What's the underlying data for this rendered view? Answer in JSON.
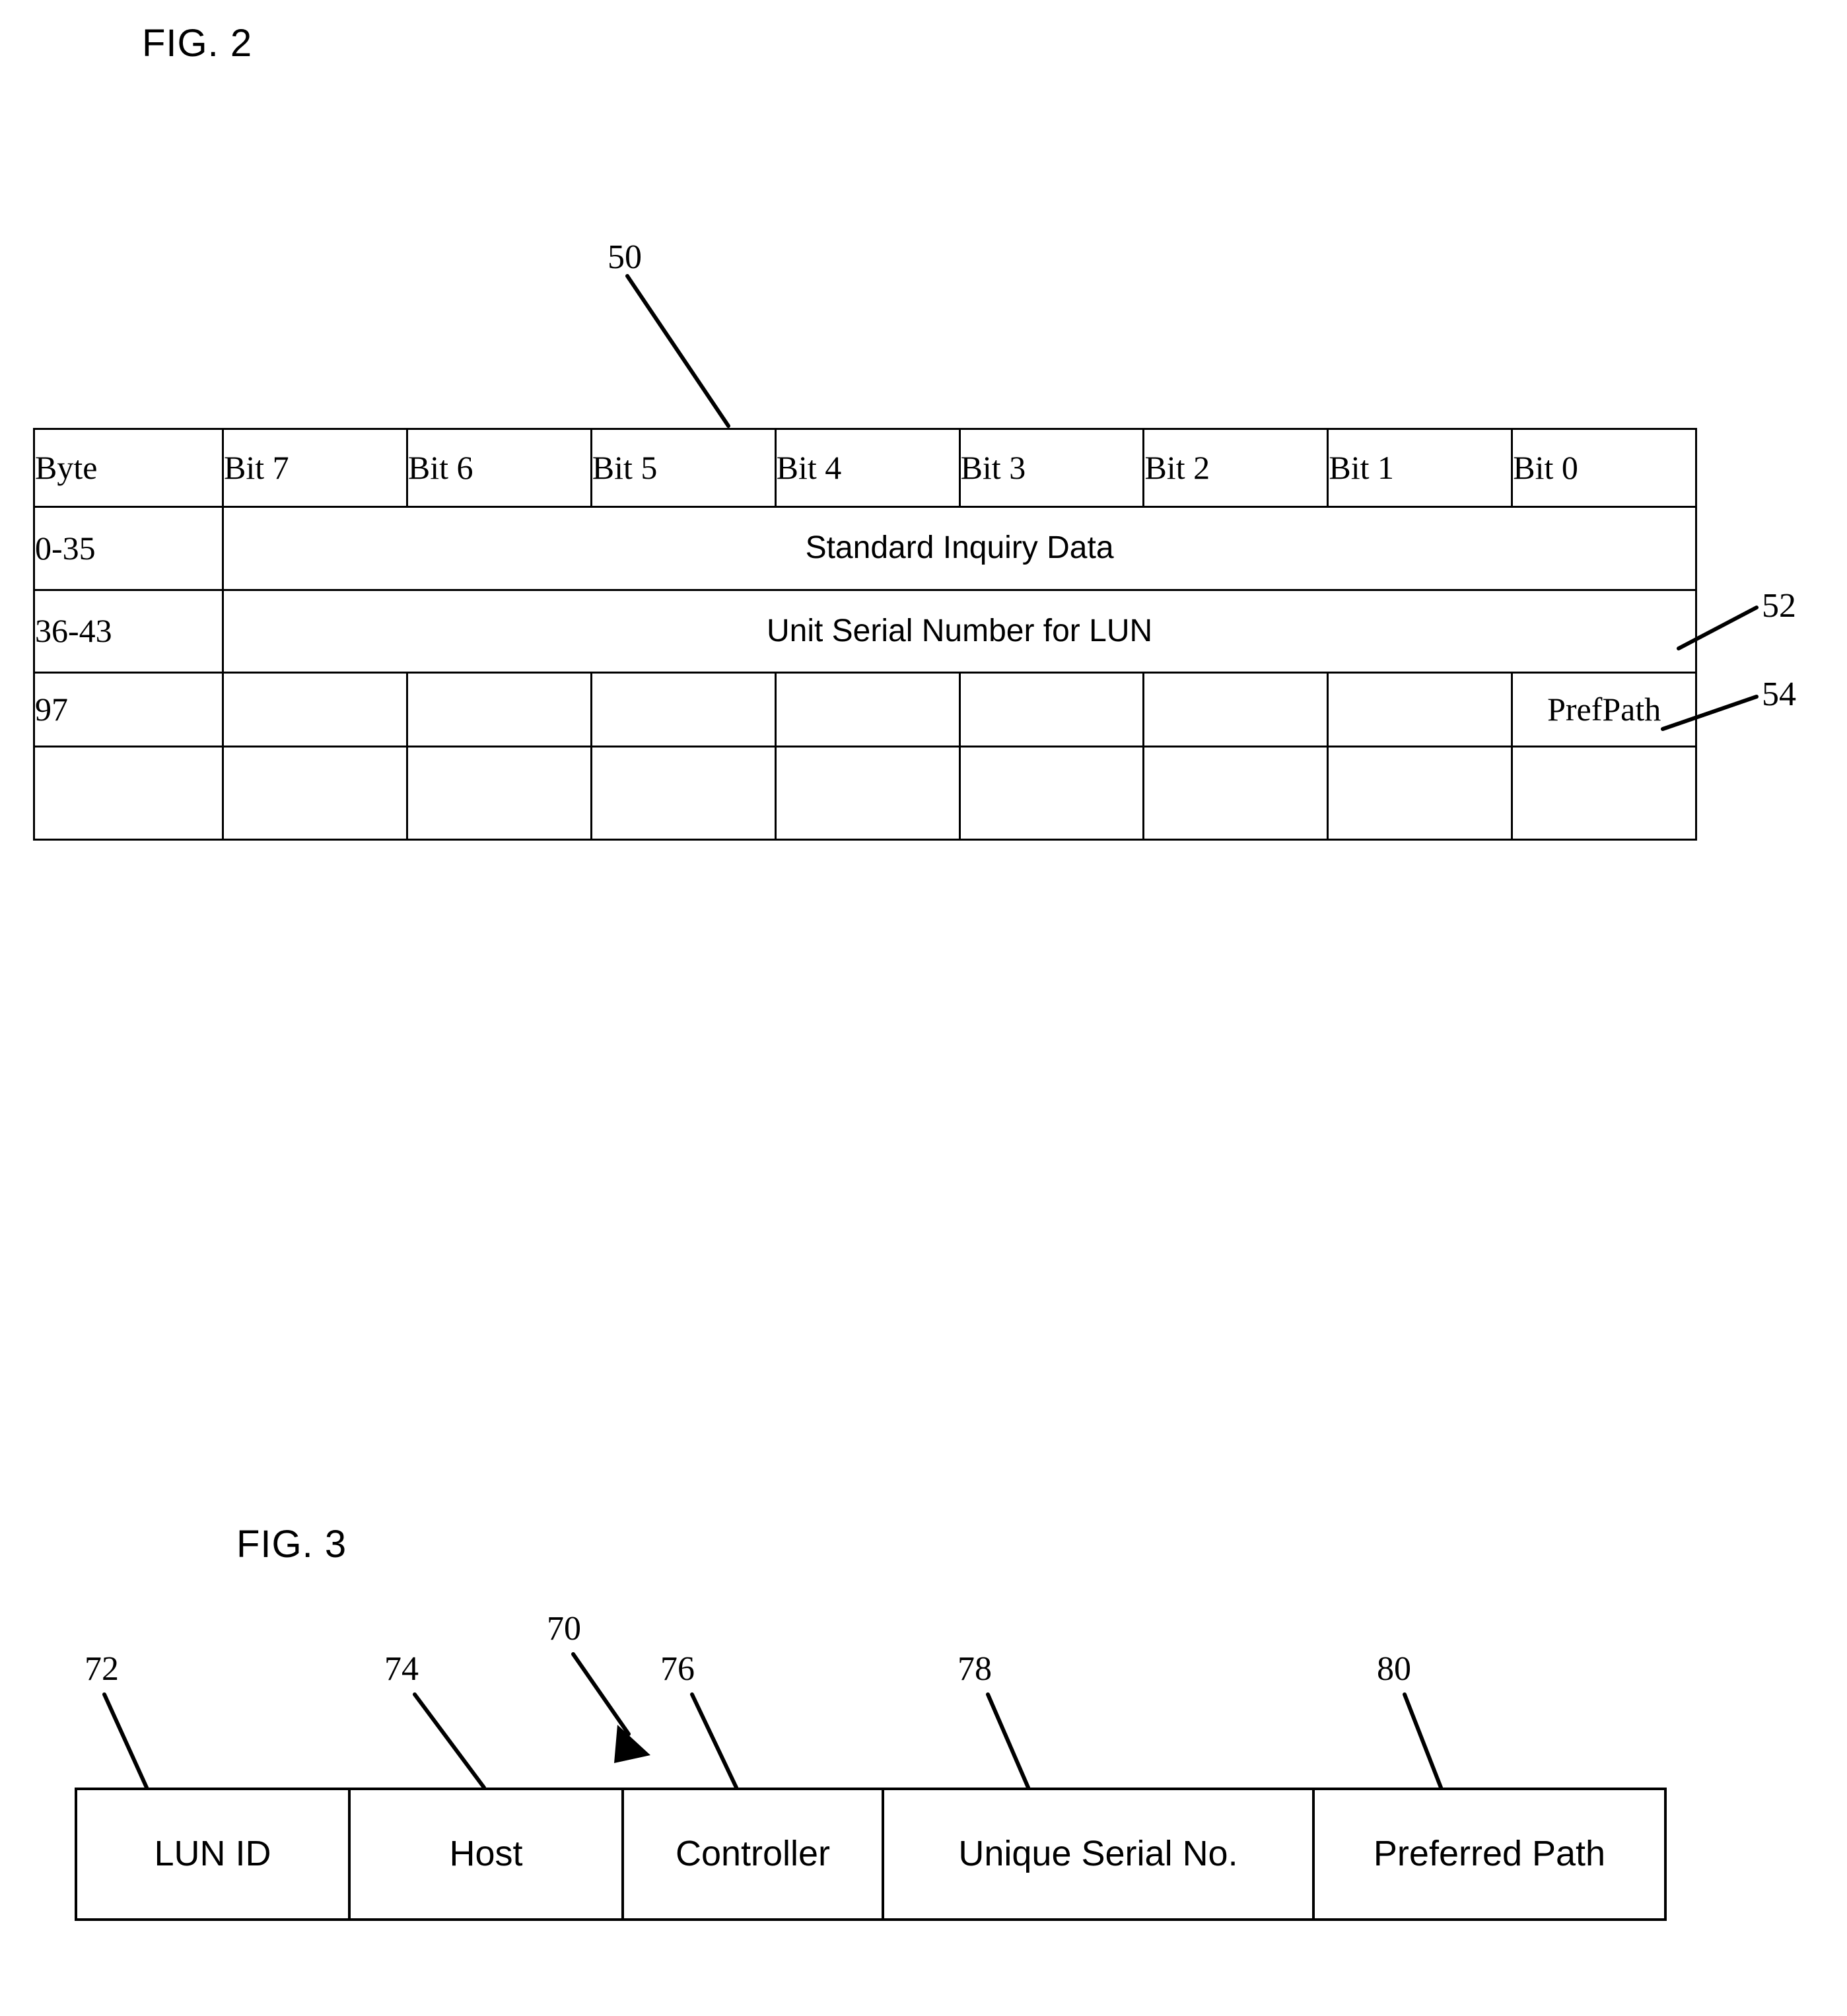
{
  "figures": {
    "fig2": {
      "caption": "FIG. 2",
      "reference_numerals": [
        {
          "label": "50",
          "target": "table-top-edge"
        },
        {
          "label": "52",
          "target": "unit-serial-number-row"
        },
        {
          "label": "54",
          "target": "prefpath-cell"
        }
      ],
      "table": {
        "columns": [
          "Byte",
          "Bit 7",
          "Bit 6",
          "Bit 5",
          "Bit 4",
          "Bit 3",
          "Bit 2",
          "Bit 1",
          "Bit 0"
        ],
        "rows": [
          {
            "byte": "0-35",
            "span_label": "Standard Inquiry Data",
            "spans_all_bits": true,
            "cells": []
          },
          {
            "byte": "36-43",
            "span_label": "Unit Serial Number for LUN",
            "spans_all_bits": true,
            "cells": []
          },
          {
            "byte": "97",
            "span_label": "",
            "spans_all_bits": false,
            "cells": [
              "",
              "",
              "",
              "",
              "",
              "",
              "",
              "PrefPath"
            ]
          },
          {
            "byte": "",
            "span_label": "",
            "spans_all_bits": false,
            "cells": [
              "",
              "",
              "",
              "",
              "",
              "",
              "",
              ""
            ]
          }
        ]
      }
    },
    "fig3": {
      "caption": "FIG. 3",
      "reference_numerals": [
        {
          "label": "70",
          "target": "record-structure"
        },
        {
          "label": "72",
          "target": "lun-id-field"
        },
        {
          "label": "74",
          "target": "host-field"
        },
        {
          "label": "76",
          "target": "controller-field"
        },
        {
          "label": "78",
          "target": "unique-serial-no-field"
        },
        {
          "label": "80",
          "target": "preferred-path-field"
        }
      ],
      "fields": [
        "LUN ID",
        "Host",
        "Controller",
        "Unique Serial No.",
        "Preferred Path"
      ]
    }
  },
  "colors": {
    "ink": "#000000",
    "paper": "#ffffff"
  }
}
